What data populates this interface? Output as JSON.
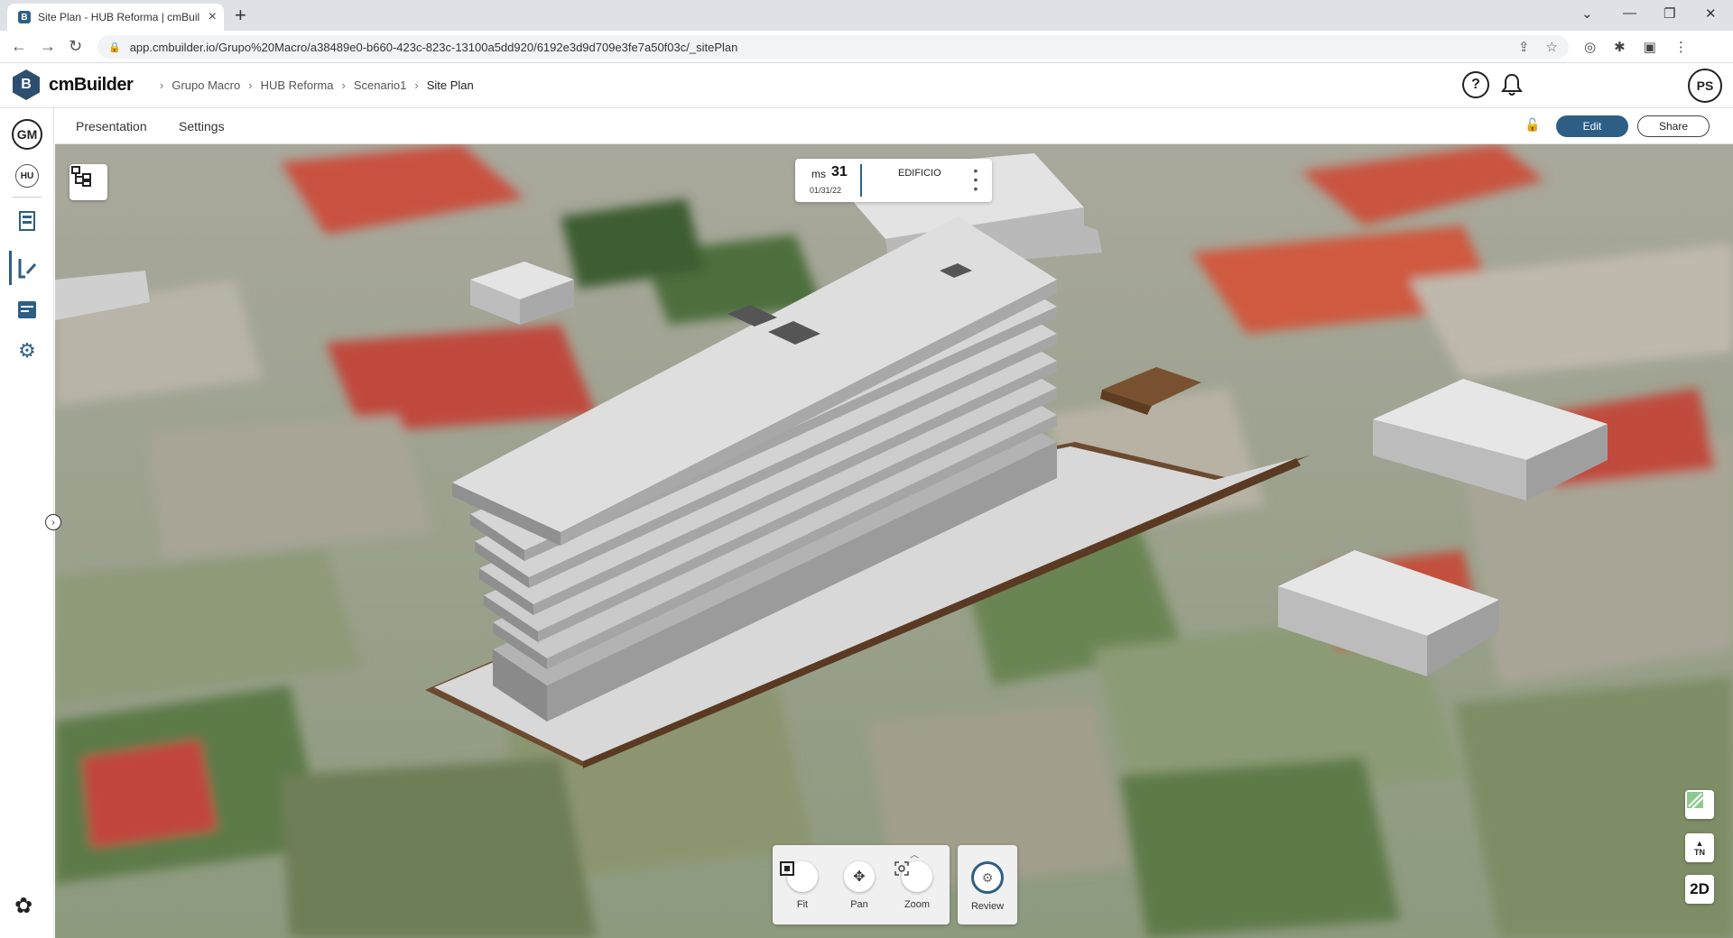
{
  "browser": {
    "tab_title": "Site Plan - HUB Reforma | cmBuil",
    "favicon_letter": "B",
    "url": "app.cmbuilder.io/Grupo%20Macro/a38489e0-b660-423c-823c-13100a5dd920/6192e3d9d709e3fe7a50f03c/_sitePlan",
    "new_tab": "+",
    "close": "×"
  },
  "app": {
    "logo_mark": "B",
    "name": "cmBuilder",
    "breadcrumb": [
      "Grupo Macro",
      "HUB Reforma",
      "Scenario1",
      "Site Plan"
    ],
    "help": "?",
    "user_initials": "PS"
  },
  "rail": {
    "org": "GM",
    "project": "HU"
  },
  "subheader": {
    "tabs": [
      "Presentation",
      "Settings"
    ],
    "edit": "Edit",
    "share": "Share"
  },
  "milestone": {
    "prefix": "ms",
    "number": "31",
    "date": "01/31/22",
    "name": "EDIFICIO"
  },
  "toolbar": {
    "tools": [
      "Fit",
      "Pan",
      "Zoom"
    ],
    "review": "Review"
  },
  "map_controls": {
    "north_label": "TN",
    "view_mode": "2D"
  },
  "colors": {
    "accent": "#2d5f86",
    "building": "#dcdcdc",
    "site_outline": "#5a3a22"
  },
  "icons": [
    "lock-icon",
    "share-page-icon",
    "star-icon",
    "extensions-icon",
    "help-icon",
    "bell-icon",
    "tree-icon",
    "fit-icon",
    "pan-icon",
    "zoom-icon",
    "review-icon",
    "layers-icon",
    "north-arrow-icon"
  ]
}
